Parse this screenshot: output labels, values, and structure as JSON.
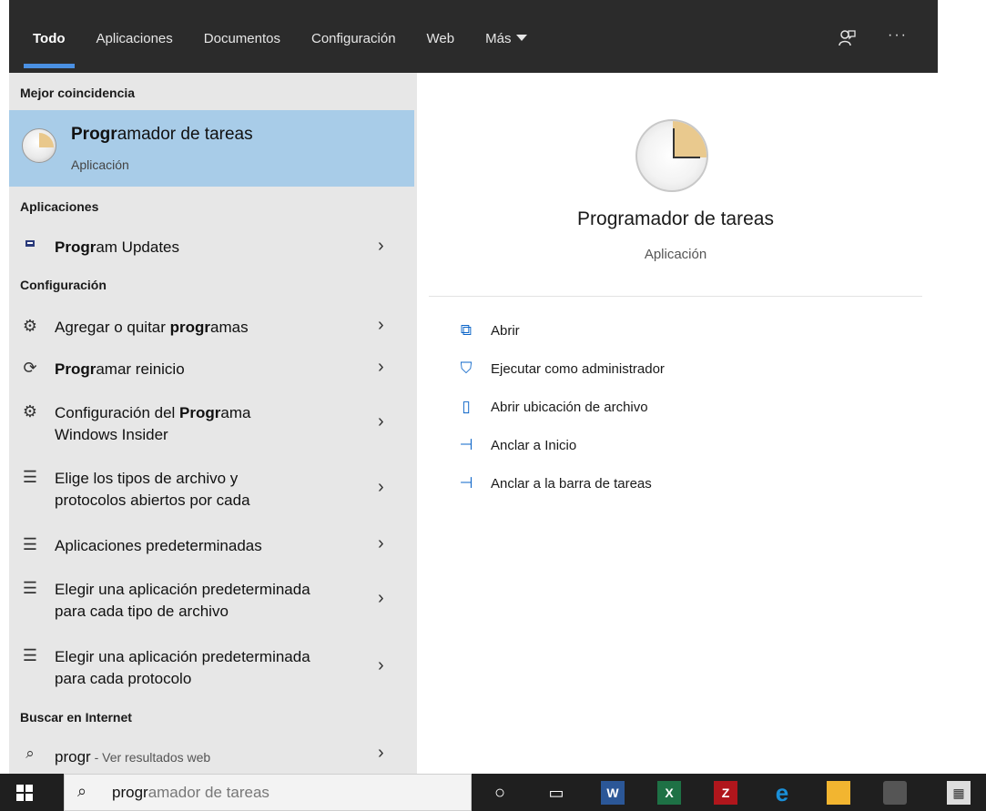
{
  "topbar": {
    "tabs": [
      {
        "label": "Todo",
        "active": true
      },
      {
        "label": "Aplicaciones",
        "active": false
      },
      {
        "label": "Documentos",
        "active": false
      },
      {
        "label": "Configuración",
        "active": false
      },
      {
        "label": "Web",
        "active": false
      },
      {
        "label": "Más",
        "active": false
      }
    ],
    "feedback_icon": "feedback-icon",
    "more_icon_glyph": "···"
  },
  "left": {
    "best_match_header": "Mejor coincidencia",
    "best_match": {
      "title_bold": "Progr",
      "title_rest": "amador de tareas",
      "subtitle": "Aplicación"
    },
    "apps_header": "Aplicaciones",
    "apps": [
      {
        "bold": "Progr",
        "rest": "am Updates",
        "icon": "program-updates-icon"
      }
    ],
    "settings_header": "Configuración",
    "settings": [
      {
        "line1_pre": "Agregar o quitar ",
        "line1_bold": "progr",
        "line1_post": "amas",
        "line2": "",
        "icon": "gear-icon"
      },
      {
        "line1_pre": "",
        "line1_bold": "Progr",
        "line1_post": "amar reinicio",
        "line2": "",
        "icon": "refresh-icon"
      },
      {
        "line1_pre": "Configuración del ",
        "line1_bold": "Progr",
        "line1_post": "ama",
        "line2": "Windows Insider",
        "icon": "gear-icon"
      },
      {
        "line1_pre": "Elige los tipos de archivo y",
        "line1_bold": "",
        "line1_post": "",
        "line2": "protocolos abiertos por cada",
        "icon": "list-icon"
      },
      {
        "line1_pre": "Aplicaciones predeterminadas",
        "line1_bold": "",
        "line1_post": "",
        "line2": "",
        "icon": "list-icon"
      },
      {
        "line1_pre": "Elegir una aplicación predeterminada",
        "line1_bold": "",
        "line1_post": "",
        "line2": "para cada tipo de archivo",
        "icon": "list-icon"
      },
      {
        "line1_pre": "Elegir una aplicación predeterminada",
        "line1_bold": "",
        "line1_post": "",
        "line2": "para cada protocolo",
        "icon": "list-icon"
      }
    ],
    "web_header": "Buscar en Internet",
    "web": {
      "query": "progr",
      "suffix": " - Ver resultados web"
    }
  },
  "right": {
    "title": "Programador de tareas",
    "subtitle": "Aplicación",
    "actions": [
      {
        "label": "Abrir",
        "icon": "open-icon"
      },
      {
        "label": "Ejecutar como administrador",
        "icon": "run-as-admin-icon"
      },
      {
        "label": "Abrir ubicación de archivo",
        "icon": "file-location-icon"
      },
      {
        "label": "Anclar a Inicio",
        "icon": "pin-icon"
      },
      {
        "label": "Anclar a la barra de tareas",
        "icon": "pin-icon"
      }
    ]
  },
  "taskbar": {
    "search_typed": "progr",
    "search_rest": "amador de tareas",
    "icons": [
      "cortana-icon",
      "task-view-icon",
      "word-icon",
      "excel-icon",
      "filezilla-icon",
      "edge-icon",
      "file-explorer-icon",
      "camera-app-icon",
      "calculator-icon"
    ]
  },
  "colors": {
    "topbar_bg": "#2b2b2b",
    "accent": "#4a90e2",
    "selected_bg": "#a8cce8",
    "left_bg": "#e7e7e7",
    "action_icon": "#0a64c8"
  }
}
